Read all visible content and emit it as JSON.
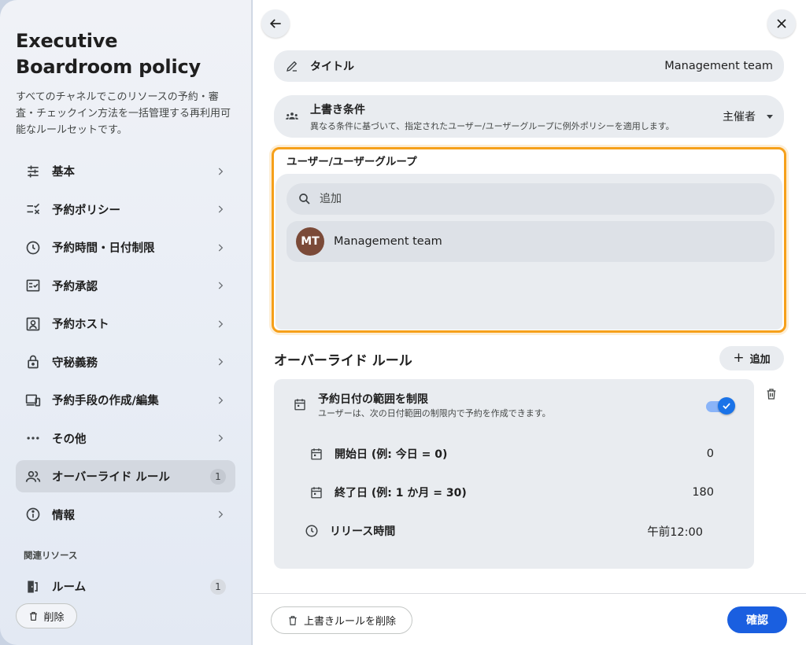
{
  "sidebar": {
    "title": "Executive Boardroom policy",
    "description": "すべてのチャネルでこのリソースの予約・審査・チェックイン方法を一括管理する再利用可能なルールセットです。",
    "items": [
      {
        "label": "基本",
        "icon": "tune-icon"
      },
      {
        "label": "予約ポリシー",
        "icon": "checklist-icon"
      },
      {
        "label": "予約時間・日付制限",
        "icon": "clock-icon"
      },
      {
        "label": "予約承認",
        "icon": "approval-icon"
      },
      {
        "label": "予約ホスト",
        "icon": "host-icon"
      },
      {
        "label": "守秘義務",
        "icon": "lock-icon"
      },
      {
        "label": "予約手段の作成/編集",
        "icon": "devices-icon"
      },
      {
        "label": "その他",
        "icon": "more-icon"
      },
      {
        "label": "オーバーライド ルール",
        "icon": "group-icon",
        "badge": "1"
      },
      {
        "label": "情報",
        "icon": "info-icon"
      }
    ],
    "related_label": "関連リソース",
    "room": {
      "label": "ルーム",
      "badge": "1"
    },
    "delete_label": "削除"
  },
  "main": {
    "title_row": {
      "label": "タイトル",
      "value": "Management team"
    },
    "override": {
      "label": "上書き条件",
      "sub": "異なる条件に基づいて、指定されたユーザー/ユーザーグループに例外ポリシーを適用します。",
      "value": "主催者"
    },
    "group": {
      "title": "ユーザー/ユーザーグループ",
      "search_placeholder": "追加",
      "member": {
        "initials": "MT",
        "name": "Management team"
      }
    },
    "rules_section": {
      "title": "オーバーライド ルール",
      "add_label": "追加"
    },
    "rule": {
      "title": "予約日付の範囲を制限",
      "sub": "ユーザーは、次の日付範囲の制限内で予約を作成できます。",
      "enabled": true,
      "rows": [
        {
          "label": "開始日 (例: 今日 = 0)",
          "value": "0"
        },
        {
          "label": "終了日 (例: 1 か月 = 30)",
          "value": "180"
        },
        {
          "label": "リリース時間",
          "value": "午前12:00"
        }
      ]
    },
    "footer": {
      "delete_label": "上書きルールを削除",
      "confirm_label": "確認"
    }
  },
  "colors": {
    "accent": "#1a5fe0",
    "focus_outline": "#f6a01a",
    "avatar": "#7b4a38"
  }
}
